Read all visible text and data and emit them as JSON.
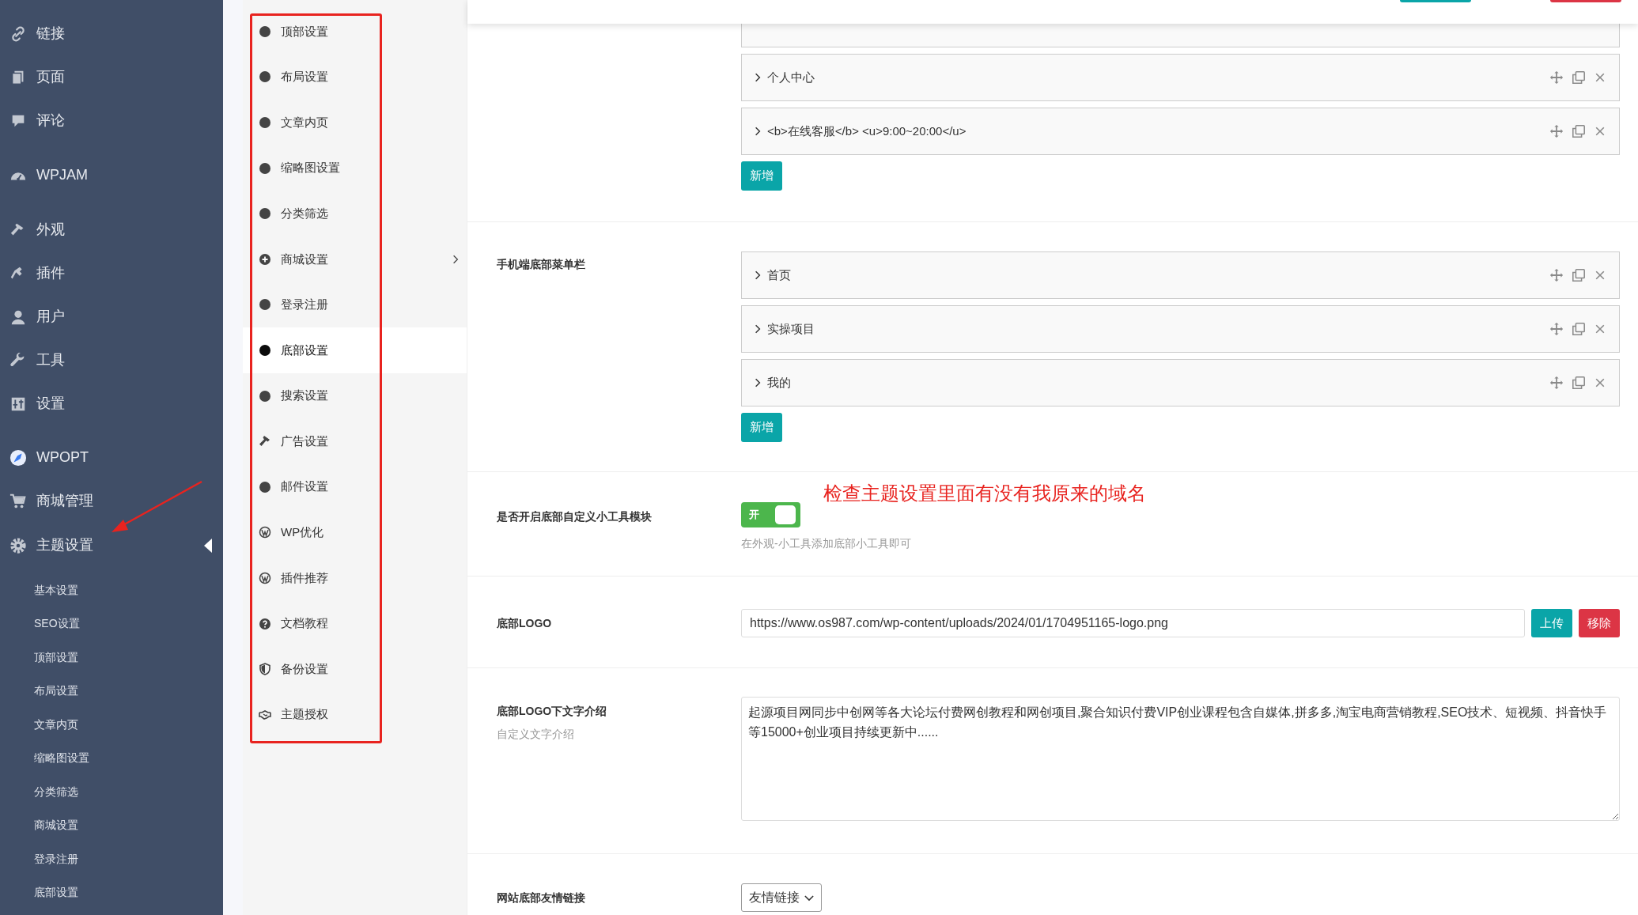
{
  "sidebar": {
    "items": [
      {
        "label": "链接",
        "selected": false
      },
      {
        "label": "页面",
        "selected": false
      },
      {
        "label": "评论",
        "selected": false
      },
      {
        "label": "WPJAM",
        "selected": false
      },
      {
        "label": "外观",
        "selected": false
      },
      {
        "label": "插件",
        "selected": false
      },
      {
        "label": "用户",
        "selected": false
      },
      {
        "label": "工具",
        "selected": false
      },
      {
        "label": "设置",
        "selected": false
      },
      {
        "label": "WPOPT",
        "selected": false
      },
      {
        "label": "商城管理",
        "selected": false
      },
      {
        "label": "主题设置",
        "selected": true
      }
    ],
    "submenu": [
      "基本设置",
      "SEO设置",
      "顶部设置",
      "布局设置",
      "文章内页",
      "缩略图设置",
      "分类筛选",
      "商城设置",
      "登录注册",
      "底部设置"
    ]
  },
  "settings_nav": {
    "items": [
      {
        "label": "顶部设置",
        "kind": "dot",
        "selected": false,
        "has_submenu": false
      },
      {
        "label": "布局设置",
        "kind": "dot",
        "selected": false,
        "has_submenu": false
      },
      {
        "label": "文章内页",
        "kind": "dot",
        "selected": false,
        "has_submenu": false
      },
      {
        "label": "缩略图设置",
        "kind": "dot",
        "selected": false,
        "has_submenu": false
      },
      {
        "label": "分类筛选",
        "kind": "dot",
        "selected": false,
        "has_submenu": false
      },
      {
        "label": "商城设置",
        "kind": "plus",
        "selected": false,
        "has_submenu": true
      },
      {
        "label": "登录注册",
        "kind": "dot",
        "selected": false,
        "has_submenu": false
      },
      {
        "label": "底部设置",
        "kind": "dot",
        "selected": true,
        "has_submenu": false
      },
      {
        "label": "搜索设置",
        "kind": "dot",
        "selected": false,
        "has_submenu": false
      },
      {
        "label": "广告设置",
        "kind": "hammer",
        "selected": false,
        "has_submenu": false
      },
      {
        "label": "邮件设置",
        "kind": "dot",
        "selected": false,
        "has_submenu": false
      },
      {
        "label": "WP优化",
        "kind": "wp",
        "selected": false,
        "has_submenu": false
      },
      {
        "label": "插件推荐",
        "kind": "wp",
        "selected": false,
        "has_submenu": false
      },
      {
        "label": "文档教程",
        "kind": "question",
        "selected": false,
        "has_submenu": false
      },
      {
        "label": "备份设置",
        "kind": "shield",
        "selected": false,
        "has_submenu": false
      },
      {
        "label": "主题授权",
        "kind": "handshake",
        "selected": false,
        "has_submenu": false
      }
    ]
  },
  "sections": [
    {
      "kind": "repeater",
      "rows": [
        {
          "kind": "clipped"
        },
        {
          "kind": "item",
          "label": "个人中心"
        },
        {
          "kind": "item",
          "label": "<b>在线客服</b> <u>9:00~20:00</u>"
        }
      ],
      "add_button": "新增"
    },
    {
      "kind": "repeater",
      "label": "手机端底部菜单栏",
      "rows": [
        {
          "kind": "item",
          "label": "首页"
        },
        {
          "kind": "item",
          "label": "实操项目"
        },
        {
          "kind": "item",
          "label": "我的"
        }
      ],
      "add_button": "新增"
    },
    {
      "kind": "toggle",
      "label": "是否开启底部自定义小工具模块",
      "on": true,
      "toggle_text": "开",
      "help": "在外观-小工具添加底部小工具即可"
    },
    {
      "kind": "upload",
      "label": "底部LOGO",
      "value": "https://www.os987.com/wp-content/uploads/2024/01/1704951165-logo.png",
      "upload_button": "上传",
      "remove_button": "移除"
    },
    {
      "kind": "textarea",
      "label": "底部LOGO下文字介绍",
      "description": "自定义文字介绍",
      "value": "起源项目网同步中创网等各大论坛付费网创教程和网创项目,聚合知识付费VIP创业课程包含自媒体,拼多多,淘宝电商营销教程,SEO技术、短视频、抖音快手等15000+创业项目持续更新中......"
    },
    {
      "kind": "select",
      "label": "网站底部友情链接",
      "value": "友情链接"
    }
  ],
  "annotation": {
    "text": "检查主题设置里面有没有我原来的域名"
  }
}
